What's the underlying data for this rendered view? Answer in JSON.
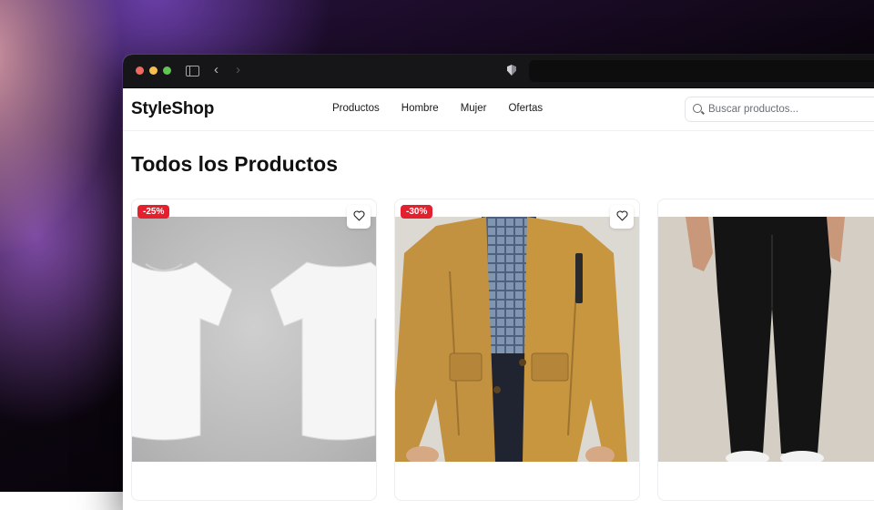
{
  "site": {
    "logo": "StyleShop",
    "nav": [
      "Productos",
      "Hombre",
      "Mujer",
      "Ofertas"
    ],
    "search": {
      "placeholder": "Buscar productos...",
      "icon": "search-icon"
    }
  },
  "page": {
    "title": "Todos los Productos"
  },
  "products": [
    {
      "badge": "-25%",
      "image": "white-tshirt-front-back"
    },
    {
      "badge": "-30%",
      "image": "mustard-parka-jacket"
    },
    {
      "badge": "",
      "image": "black-pants"
    }
  ],
  "colors": {
    "badge": "#e5202e",
    "window_chrome": "#161618"
  }
}
